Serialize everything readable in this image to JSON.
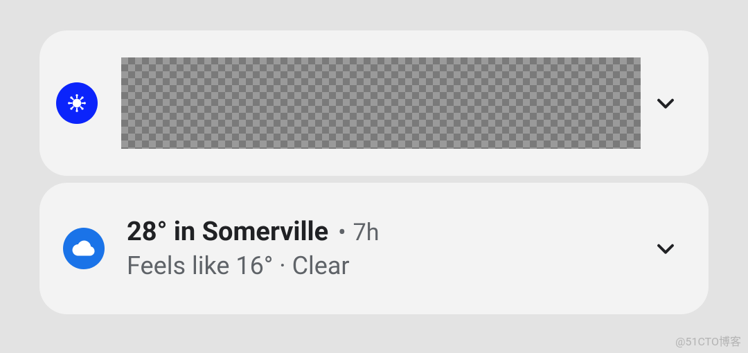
{
  "notifications": {
    "covid": {
      "icon": "virus-icon",
      "content_redacted": true
    },
    "weather": {
      "icon": "cloud-icon",
      "title": "28° in Somerville",
      "separator": "•",
      "time": "7h",
      "subtitle": "Feels like 16° · Clear"
    }
  },
  "watermark": "@51CTO博客",
  "colors": {
    "covid_icon_bg": "#0b24fb",
    "weather_icon_bg": "#1a73e8",
    "card_bg": "#f3f3f3",
    "page_bg": "#e3e3e3"
  }
}
